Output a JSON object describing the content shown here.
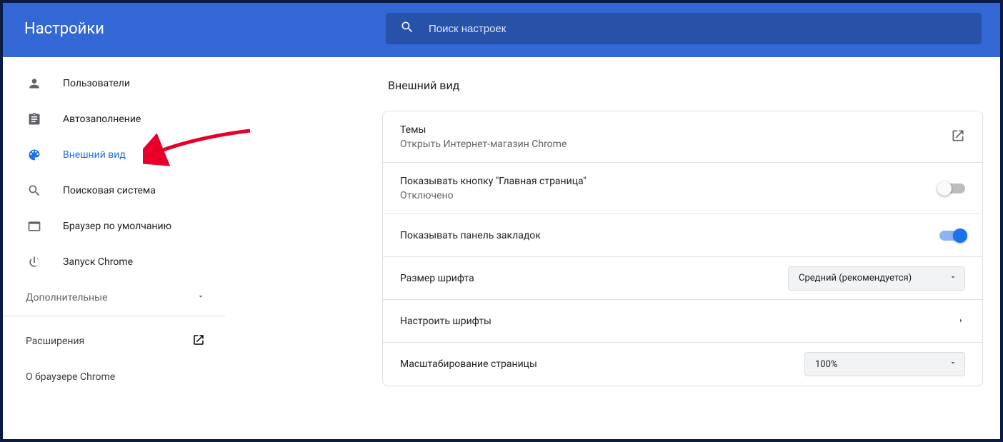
{
  "header": {
    "title": "Настройки",
    "search_placeholder": "Поиск настроек"
  },
  "sidebar": {
    "items": [
      {
        "label": "Пользователи"
      },
      {
        "label": "Автозаполнение"
      },
      {
        "label": "Внешний вид"
      },
      {
        "label": "Поисковая система"
      },
      {
        "label": "Браузер по умолчанию"
      },
      {
        "label": "Запуск Chrome"
      }
    ],
    "advanced": "Дополнительные",
    "extensions": "Расширения",
    "about": "О браузере Chrome"
  },
  "main": {
    "section_title": "Внешний вид",
    "themes": {
      "title": "Темы",
      "sub": "Открыть Интернет-магазин Chrome"
    },
    "home_button": {
      "title": "Показывать кнопку \"Главная страница\"",
      "sub": "Отключено"
    },
    "bookmarks_bar": {
      "title": "Показывать панель закладок"
    },
    "font_size": {
      "title": "Размер шрифта",
      "value": "Средний (рекомендуется)"
    },
    "customize_fonts": {
      "title": "Настроить шрифты"
    },
    "page_zoom": {
      "title": "Масштабирование страницы",
      "value": "100%"
    }
  }
}
